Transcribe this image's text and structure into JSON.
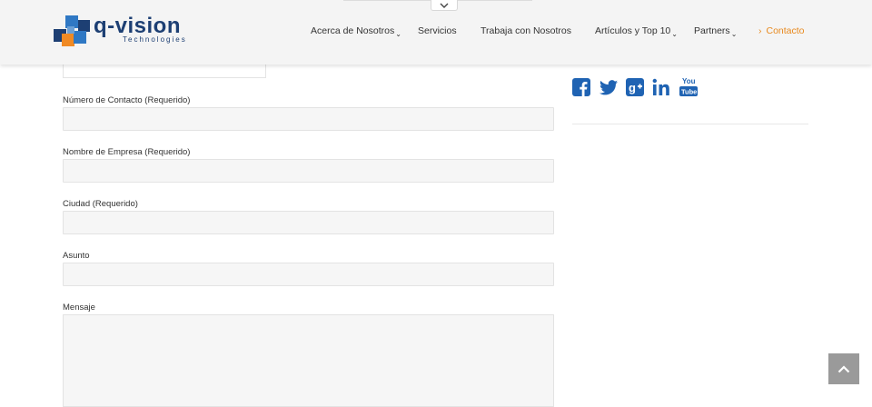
{
  "brand": {
    "name": "q-vision",
    "tagline": "Technologies",
    "colors": {
      "navy": "#1d3f73",
      "blue": "#2f78c4",
      "orange": "#f08a24",
      "social": "#1f63b3"
    }
  },
  "nav": {
    "items": [
      {
        "label": "Acerca de Nosotros",
        "has_dropdown": true
      },
      {
        "label": "Servicios",
        "has_dropdown": false
      },
      {
        "label": "Trabaja con Nosotros",
        "has_dropdown": false
      },
      {
        "label": "Artículos y Top 10",
        "has_dropdown": true
      },
      {
        "label": "Partners",
        "has_dropdown": true
      },
      {
        "label": "Contacto",
        "has_dropdown": false,
        "active": true
      }
    ],
    "active_color": "#e8891d",
    "caret_glyph": "⌄",
    "active_marker": "›"
  },
  "form": {
    "fields": [
      {
        "label": "Número de Contacto (Requerido)",
        "value": ""
      },
      {
        "label": "Nombre de Empresa (Requerido)",
        "value": ""
      },
      {
        "label": "Ciudad (Requerido)",
        "value": ""
      },
      {
        "label": "Asunto",
        "value": ""
      },
      {
        "label": "Mensaje",
        "value": ""
      }
    ]
  },
  "social": {
    "icons": [
      "facebook-icon",
      "twitter-icon",
      "google-plus-icon",
      "linkedin-icon",
      "youtube-icon"
    ],
    "youtube_text_top": "You",
    "youtube_text_bottom": "Tube",
    "linkedin_text": "in"
  },
  "back_to_top": {
    "icon": "chevron-up-icon"
  }
}
